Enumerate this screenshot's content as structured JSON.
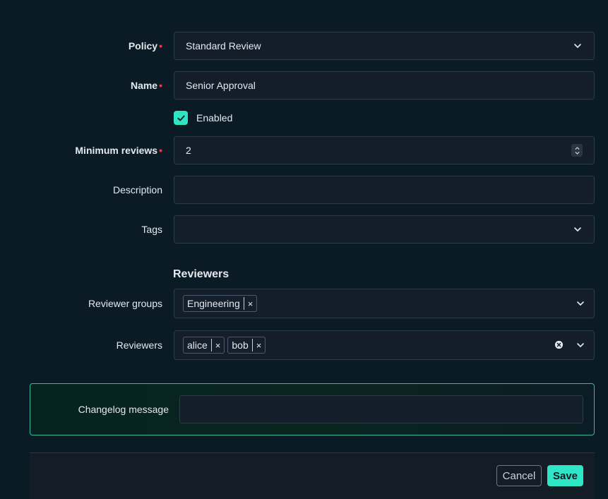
{
  "form": {
    "policy": {
      "label": "Policy",
      "value": "Standard Review",
      "required": "•"
    },
    "name": {
      "label": "Name",
      "value": "Senior Approval",
      "required": "•"
    },
    "enabled": {
      "label": "Enabled",
      "checked": true
    },
    "minimum_reviews": {
      "label": "Minimum reviews",
      "value": "2",
      "required": "•"
    },
    "description": {
      "label": "Description",
      "value": ""
    },
    "tags": {
      "label": "Tags",
      "value": ""
    }
  },
  "reviewers_section": {
    "title": "Reviewers",
    "reviewer_groups": {
      "label": "Reviewer groups",
      "chips": [
        "Engineering"
      ]
    },
    "reviewers": {
      "label": "Reviewers",
      "chips": [
        "alice",
        "bob"
      ]
    }
  },
  "changelog": {
    "label": "Changelog message",
    "value": ""
  },
  "footer": {
    "cancel_label": "Cancel",
    "save_label": "Save"
  },
  "icons": {
    "chip_remove": "×",
    "dropdown": "chevron-down-icon",
    "clear": "clear-circle-icon",
    "check": "check-icon",
    "stepper": "number-stepper-icon"
  },
  "colors": {
    "background": "#0b1b26",
    "accent": "#2ee6c6",
    "required": "#d9434d",
    "input_bg": "#131e2a",
    "border": "#2e3b49"
  }
}
